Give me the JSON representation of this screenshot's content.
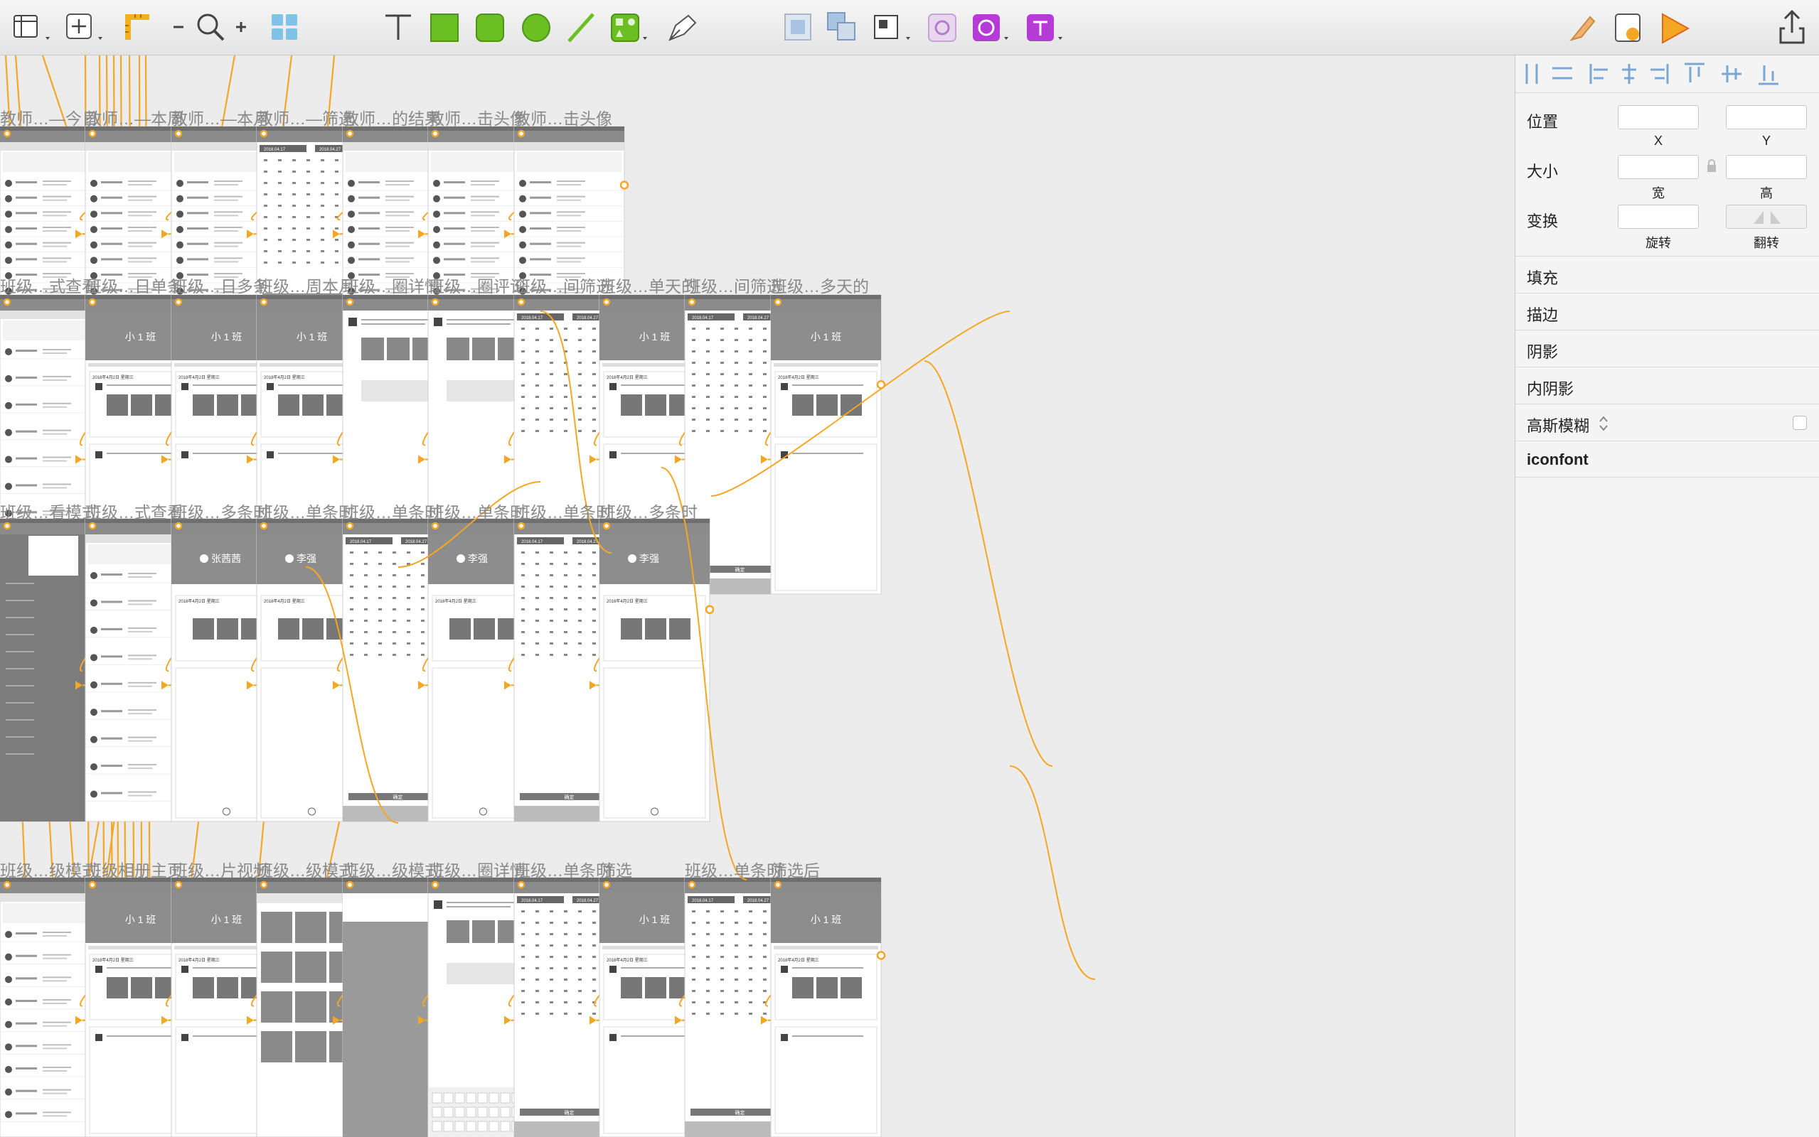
{
  "toolbar": {
    "tools": [
      "layout-icon",
      "insert-icon",
      "ruler-icon",
      "zoom-out-icon",
      "zoom-icon",
      "zoom-in-icon",
      "symbols-icon",
      "text-tool-icon",
      "rectangle-tool-icon",
      "rounded-rect-tool-icon",
      "oval-tool-icon",
      "line-tool-icon",
      "shapes-tool-icon",
      "pen-tool-icon",
      "group-icon",
      "ungroup-icon",
      "resize-icon",
      "refresh-icon",
      "plugin-icon",
      "type-plugin-icon",
      "edit-icon",
      "preview-icon",
      "play-icon",
      "share-icon"
    ],
    "accent_green": "#6bbf22",
    "accent_purple": "#b63bd6",
    "accent_orange": "#f5a623"
  },
  "inspector": {
    "position_label": "位置",
    "x_label": "X",
    "y_label": "Y",
    "size_label": "大小",
    "width_label": "宽",
    "height_label": "高",
    "transform_label": "变换",
    "rotate_label": "旋转",
    "flip_label": "翻转",
    "sections": [
      "填充",
      "描边",
      "阴影",
      "内阴影",
      "高斯模糊"
    ],
    "iconfont_label": "iconfont"
  },
  "artboards": {
    "row1": [
      "教师…—今日",
      "教师…—本周",
      "教师…—本月",
      "教师…—筛选",
      "教师…的结果",
      "教师…击头像",
      "教师…击头像"
    ],
    "row2": [
      "班级…式查看",
      "班级…日单条",
      "班级…日多条",
      "班级…周本月",
      "班级…圈详情",
      "班级…圈评论",
      "班级…间筛选",
      "班级…单天的",
      "班级…间筛选",
      "班级…多天的"
    ],
    "row3": [
      "班级…看模式",
      "班级…式查看",
      "班级…多条时",
      "班级…单条时",
      "班级…单条时",
      "班级…单条时",
      "班级…单条时",
      "班级…多条时"
    ],
    "row4": [
      "班级…级模式",
      "班级相册主页",
      "班级…片视频",
      "班级…级模式",
      "班级…级模式",
      "班级…圈详情",
      "班级…单条时",
      "筛选",
      "班级…单条时",
      "筛选后"
    ]
  },
  "screen_text": {
    "class_name": "小 1 班",
    "student_1": "张茜茜",
    "student_2": "李强",
    "confirm": "确定",
    "date_a": "2018.04.17",
    "date_b": "2018.04.27",
    "date_heading": "2018年4月2日 星期三",
    "flow_color": "#f5a623"
  }
}
